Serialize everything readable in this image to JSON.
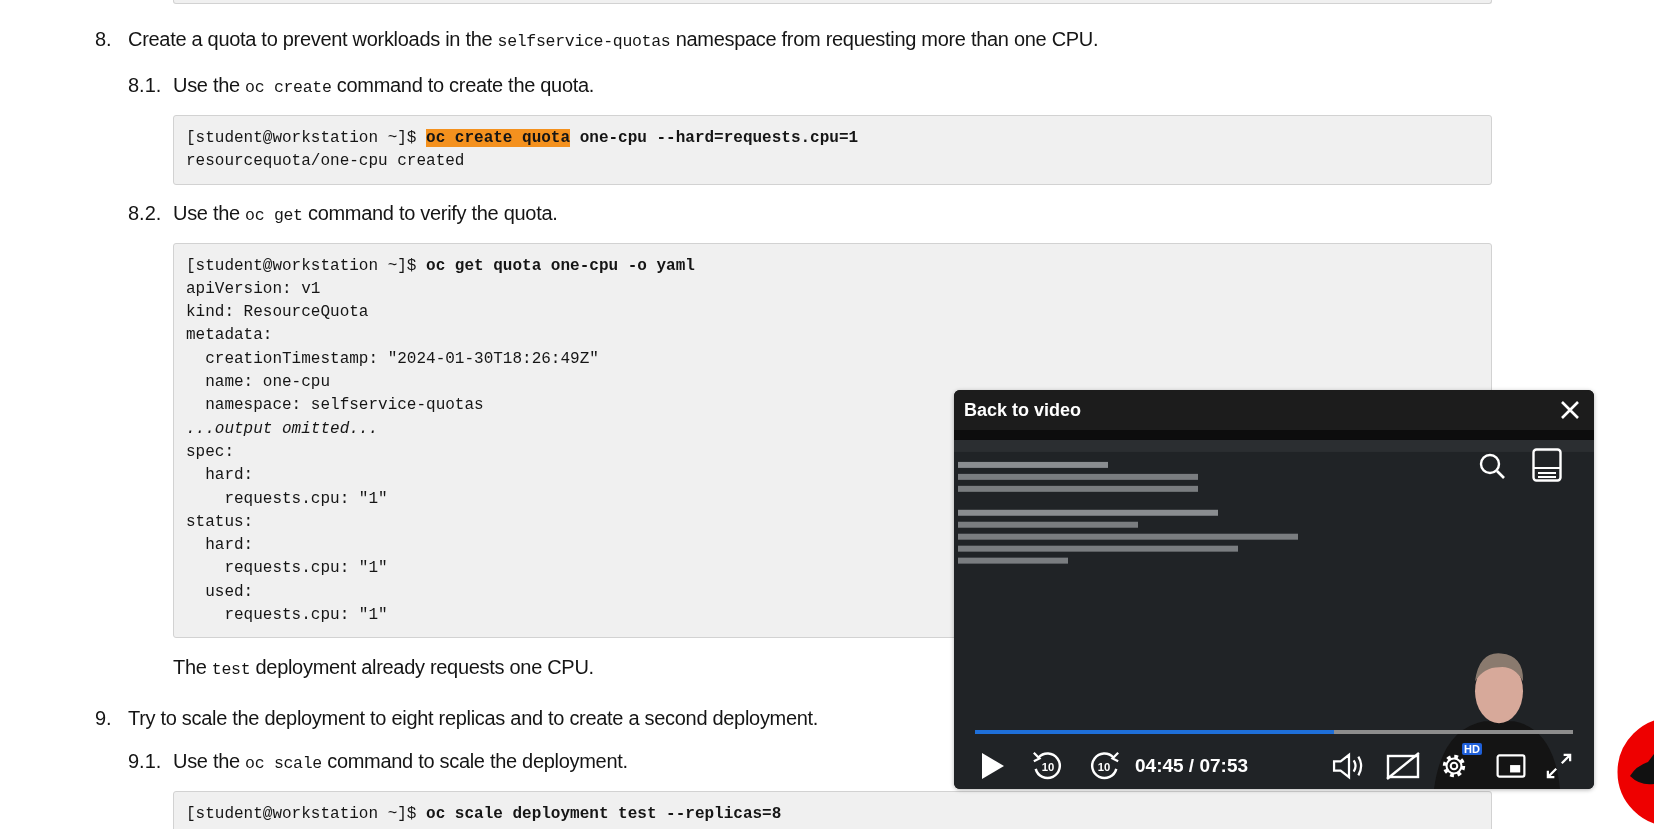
{
  "steps": [
    {
      "number": "8.",
      "text": [
        {
          "kind": "text",
          "t": "Create a quota to prevent workloads in the "
        },
        {
          "kind": "code",
          "t": "selfservice-quotas"
        },
        {
          "kind": "text",
          "t": " namespace from requesting more than one CPU."
        }
      ],
      "substeps": [
        {
          "number": "8.1.",
          "text": [
            {
              "kind": "text",
              "t": "Use the "
            },
            {
              "kind": "code",
              "t": "oc create"
            },
            {
              "kind": "text",
              "t": " command to create the quota."
            }
          ],
          "code": [
            [
              {
                "kind": "plain",
                "t": "[student@workstation ~]$ "
              },
              {
                "kind": "mark",
                "t": "oc create quota"
              },
              {
                "kind": "bold",
                "t": " one-cpu --hard=requests.cpu=1"
              }
            ],
            [
              {
                "kind": "plain",
                "t": "resourcequota/one-cpu created"
              }
            ]
          ]
        },
        {
          "number": "8.2.",
          "text": [
            {
              "kind": "text",
              "t": "Use the "
            },
            {
              "kind": "code",
              "t": "oc get"
            },
            {
              "kind": "text",
              "t": " command to verify the quota."
            }
          ],
          "code": [
            [
              {
                "kind": "plain",
                "t": "[student@workstation ~]$ "
              },
              {
                "kind": "bold",
                "t": "oc get quota one-cpu -o yaml"
              }
            ],
            [
              {
                "kind": "plain",
                "t": "apiVersion: v1"
              }
            ],
            [
              {
                "kind": "plain",
                "t": "kind: ResourceQuota"
              }
            ],
            [
              {
                "kind": "plain",
                "t": "metadata:"
              }
            ],
            [
              {
                "kind": "plain",
                "t": "  creationTimestamp: \"2024-01-30T18:26:49Z\""
              }
            ],
            [
              {
                "kind": "plain",
                "t": "  name: one-cpu"
              }
            ],
            [
              {
                "kind": "plain",
                "t": "  namespace: selfservice-quotas"
              }
            ],
            [
              {
                "kind": "italic",
                "t": "...output omitted..."
              }
            ],
            [
              {
                "kind": "plain",
                "t": "spec:"
              }
            ],
            [
              {
                "kind": "plain",
                "t": "  hard:"
              }
            ],
            [
              {
                "kind": "plain",
                "t": "    requests.cpu: \"1\""
              }
            ],
            [
              {
                "kind": "plain",
                "t": "status:"
              }
            ],
            [
              {
                "kind": "plain",
                "t": "  hard:"
              }
            ],
            [
              {
                "kind": "plain",
                "t": "    requests.cpu: \"1\""
              }
            ],
            [
              {
                "kind": "plain",
                "t": "  used:"
              }
            ],
            [
              {
                "kind": "plain",
                "t": "    requests.cpu: \"1\""
              }
            ]
          ],
          "note": [
            {
              "kind": "text",
              "t": "The "
            },
            {
              "kind": "code",
              "t": "test"
            },
            {
              "kind": "text",
              "t": " deployment already requests one CPU."
            }
          ]
        }
      ]
    },
    {
      "number": "9.",
      "text": [
        {
          "kind": "text",
          "t": "Try to scale the deployment to eight replicas and to create a second deployment."
        }
      ],
      "substeps": [
        {
          "number": "9.1.",
          "text": [
            {
              "kind": "text",
              "t": "Use the "
            },
            {
              "kind": "code",
              "t": "oc scale"
            },
            {
              "kind": "text",
              "t": " command to scale the deployment."
            }
          ],
          "code": [
            [
              {
                "kind": "plain",
                "t": "[student@workstation ~]$ "
              },
              {
                "kind": "bold",
                "t": "oc scale deployment test --replicas=8"
              }
            ]
          ]
        }
      ]
    }
  ],
  "player": {
    "title": "Back to video",
    "kind": "picture",
    "progress": {
      "level": 0.6
    },
    "skip_back": "10",
    "skip_forward": "10",
    "time": "04:45 / 07:53",
    "quality_badge": "HD"
  }
}
